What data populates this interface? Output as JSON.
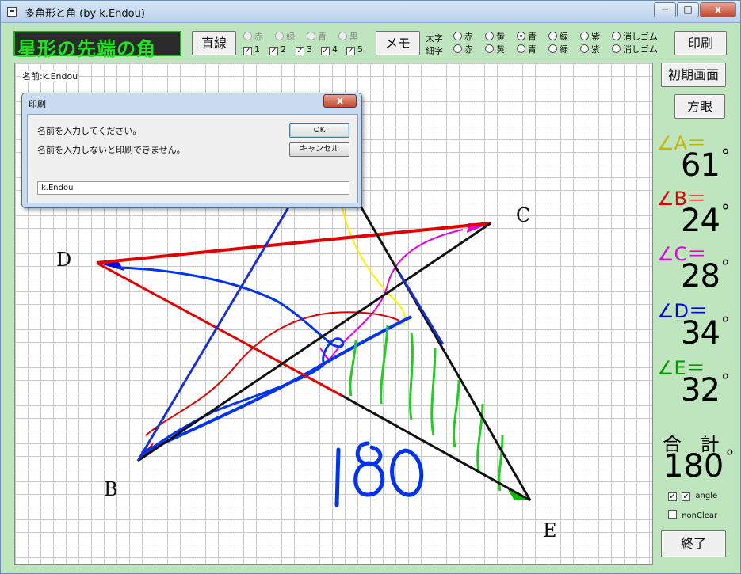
{
  "window": {
    "title": "多角形と角 (by k.Endou)",
    "min_label": "−",
    "max_label": "□",
    "close_label": "x"
  },
  "heading": "星形の先端の角",
  "toolbar": {
    "line_button": "直線",
    "line_colors": [
      "赤",
      "緑",
      "青",
      "黒"
    ],
    "line_checks": [
      "1",
      "2",
      "3",
      "4",
      "5"
    ],
    "memo_button": "メモ",
    "thick_label": "太字",
    "thin_label": "細字",
    "pen_options": [
      "赤",
      "黄",
      "青",
      "緑",
      "紫",
      "消しゴム"
    ],
    "selected_pen": "太字-青",
    "print_button": "印刷"
  },
  "side": {
    "init_button": "初期画面",
    "grid_button": "方眼",
    "angles": [
      {
        "label": "∠A＝",
        "value": "61",
        "color": "#c8b400"
      },
      {
        "label": "∠B＝",
        "value": "24",
        "color": "#e00000"
      },
      {
        "label": "∠C＝",
        "value": "28",
        "color": "#e000e0"
      },
      {
        "label": "∠D＝",
        "value": "34",
        "color": "#0000e0"
      },
      {
        "label": "∠E＝",
        "value": "32",
        "color": "#009900"
      }
    ],
    "degree_symbol": "°",
    "total_label": "合 計",
    "total_value": "180",
    "angle_check_label": "angle",
    "nonclear_label": "nonClear",
    "end_button": "終了"
  },
  "canvas": {
    "name_text": "名前:k.Endou",
    "vertices": [
      "C",
      "D",
      "B",
      "E"
    ],
    "handwritten_note": "180"
  },
  "dialog": {
    "title": "印刷",
    "close_label": "x",
    "message1": "名前を入力してください。",
    "message2": "名前を入力しないと印刷できません。",
    "ok": "OK",
    "cancel": "キャンセル",
    "input_value": "k.Endou"
  }
}
